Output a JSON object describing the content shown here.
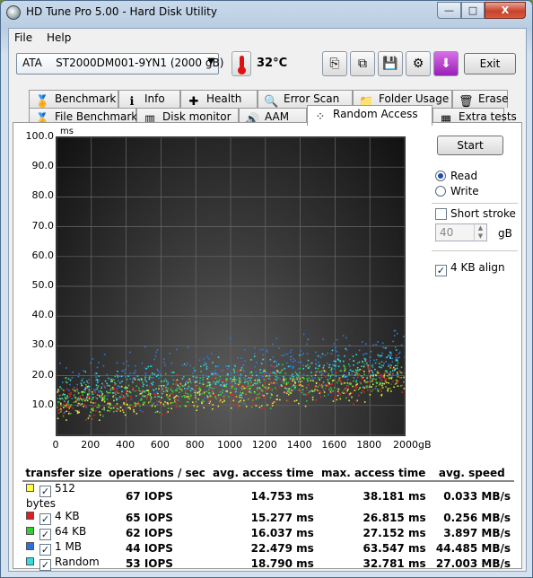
{
  "window": {
    "title": "HD Tune Pro 5.00 - Hard Disk Utility",
    "controls": {
      "minimize": "—",
      "maximize": "□",
      "close": "X"
    }
  },
  "menu": {
    "file": "File",
    "help": "Help"
  },
  "toolbar": {
    "drive": "ATA    ST2000DM001-9YN1 (2000 gB)",
    "temperature": "32°C",
    "exit_label": "Exit",
    "buttons": [
      {
        "name": "copy-info-icon",
        "glyph": "⎘"
      },
      {
        "name": "copy-screenshot-icon",
        "glyph": "⧉"
      },
      {
        "name": "save-icon",
        "glyph": "💾"
      },
      {
        "name": "options-icon",
        "glyph": "⚙"
      },
      {
        "name": "download-icon",
        "glyph": "⬇"
      }
    ]
  },
  "tabs_top": [
    {
      "label": "Benchmark",
      "icon": "ribbon-icon",
      "glyph": "🏅"
    },
    {
      "label": "Info",
      "icon": "info-icon",
      "glyph": "ℹ"
    },
    {
      "label": "Health",
      "icon": "health-cross-icon",
      "glyph": "✚"
    },
    {
      "label": "Error Scan",
      "icon": "magnifier-icon",
      "glyph": "🔍"
    },
    {
      "label": "Folder Usage",
      "icon": "folder-icon",
      "glyph": "📁"
    },
    {
      "label": "Erase",
      "icon": "trash-icon",
      "glyph": "🗑"
    }
  ],
  "tabs_bottom": [
    {
      "label": "File Benchmark",
      "icon": "file-benchmark-icon",
      "glyph": "🏅"
    },
    {
      "label": "Disk monitor",
      "icon": "disk-monitor-icon",
      "glyph": "▥"
    },
    {
      "label": "AAM",
      "icon": "speaker-icon",
      "glyph": "🔊"
    },
    {
      "label": "Random Access",
      "icon": "random-access-icon",
      "glyph": "⁘",
      "active": true
    },
    {
      "label": "Extra tests",
      "icon": "extra-tests-icon",
      "glyph": "▦"
    }
  ],
  "controls": {
    "start_label": "Start",
    "read_label": "Read",
    "write_label": "Write",
    "short_stroke_label": "Short stroke",
    "short_stroke_value": "40",
    "short_stroke_unit": "gB",
    "align_label": "4 KB align"
  },
  "chart_data": {
    "type": "scatter",
    "ylabel": "ms",
    "xlabel": "",
    "x_tick_labels": [
      "0",
      "200",
      "400",
      "600",
      "800",
      "1000",
      "1200",
      "1400",
      "1600",
      "1800",
      "2000gB"
    ],
    "y_tick_labels": [
      "10.0",
      "20.0",
      "30.0",
      "40.0",
      "50.0",
      "60.0",
      "70.0",
      "80.0",
      "90.0",
      "100.0"
    ],
    "xlim": [
      0,
      2000
    ],
    "ylim": [
      0,
      100
    ],
    "grid": true,
    "series": [
      {
        "name": "512 bytes",
        "color": "#e8e83a",
        "trend": [
          [
            0,
            11
          ],
          [
            1000,
            14
          ],
          [
            2000,
            19
          ]
        ]
      },
      {
        "name": "4 KB",
        "color": "#d82a2a",
        "trend": [
          [
            0,
            11.5
          ],
          [
            1000,
            15
          ],
          [
            2000,
            20
          ]
        ]
      },
      {
        "name": "64 KB",
        "color": "#36c836",
        "trend": [
          [
            0,
            12
          ],
          [
            1000,
            16
          ],
          [
            2000,
            21
          ]
        ]
      },
      {
        "name": "1 MB",
        "color": "#2e7ad8",
        "trend": [
          [
            0,
            17
          ],
          [
            1000,
            22
          ],
          [
            2000,
            27
          ]
        ]
      },
      {
        "name": "Random",
        "color": "#3ad8d8",
        "trend": [
          [
            0,
            14
          ],
          [
            1000,
            19
          ],
          [
            2000,
            24
          ]
        ]
      }
    ]
  },
  "results": {
    "headers": [
      "transfer size",
      "operations / sec",
      "avg. access time",
      "max. access time",
      "avg. speed"
    ],
    "rows": [
      {
        "name": "512 bytes",
        "color": "#ffff40",
        "ops": "67 IOPS",
        "avg": "14.753 ms",
        "max": "38.181 ms",
        "speed": "0.033 MB/s"
      },
      {
        "name": "4 KB",
        "color": "#e02020",
        "ops": "65 IOPS",
        "avg": "15.277 ms",
        "max": "26.815 ms",
        "speed": "0.256 MB/s"
      },
      {
        "name": "64 KB",
        "color": "#30d030",
        "ops": "62 IOPS",
        "avg": "16.037 ms",
        "max": "27.152 ms",
        "speed": "3.897 MB/s"
      },
      {
        "name": "1 MB",
        "color": "#2e6ee0",
        "ops": "44 IOPS",
        "avg": "22.479 ms",
        "max": "63.547 ms",
        "speed": "44.485 MB/s"
      },
      {
        "name": "Random",
        "color": "#30e0e0",
        "ops": "53 IOPS",
        "avg": "18.790 ms",
        "max": "32.781 ms",
        "speed": "27.003 MB/s"
      }
    ]
  }
}
